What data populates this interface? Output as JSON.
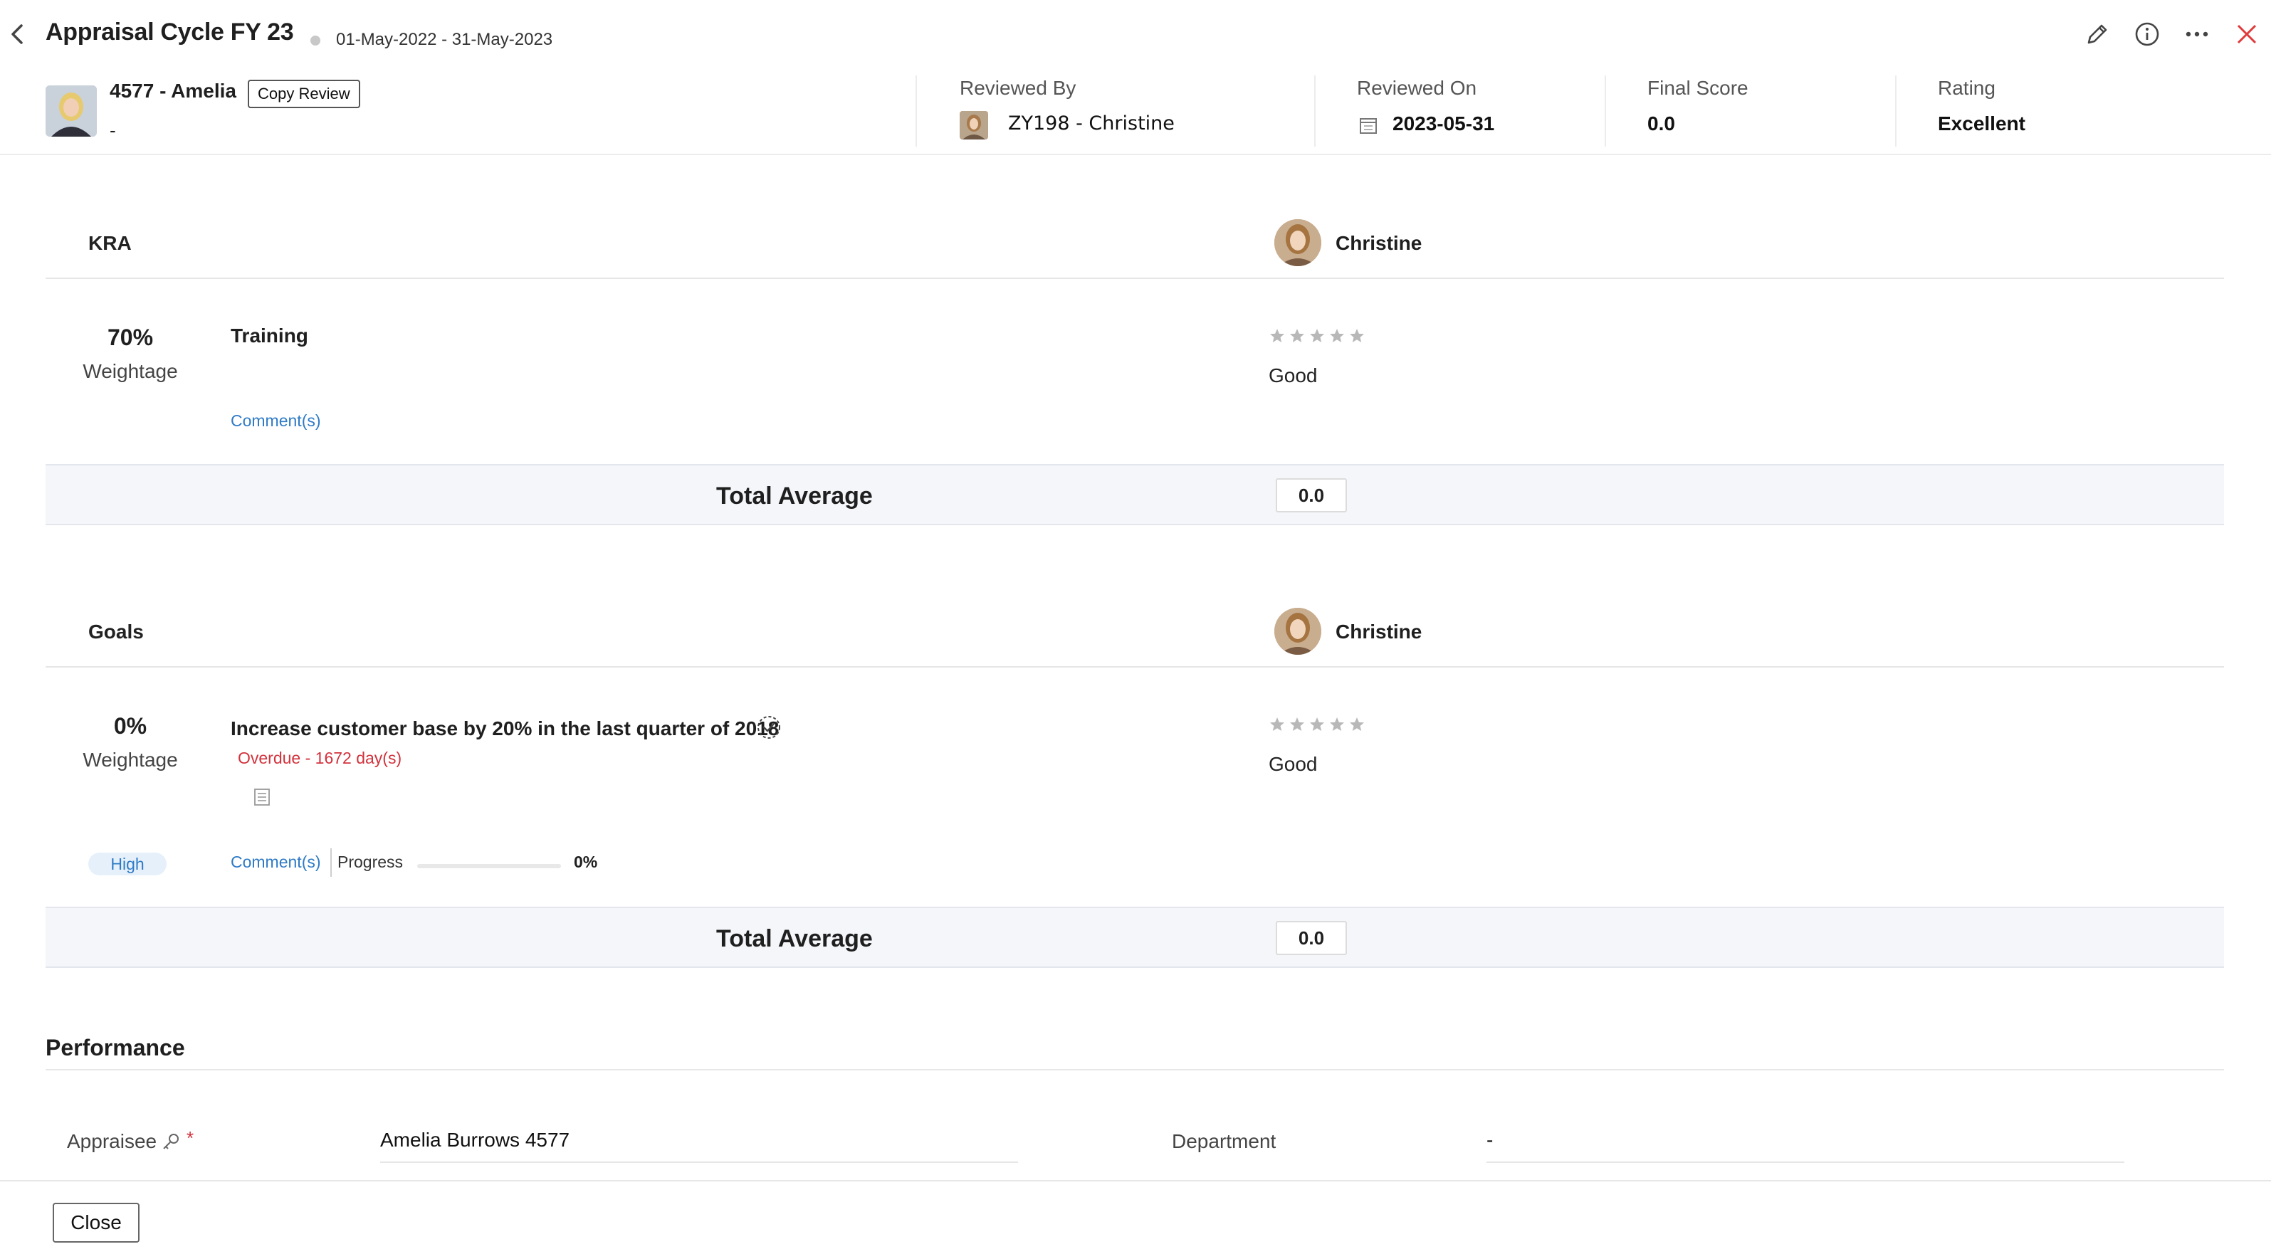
{
  "header": {
    "title": "Appraisal Cycle FY 23",
    "date_range": "01-May-2022 - 31-May-2023",
    "icons": [
      "back-icon",
      "edit-icon",
      "info-icon",
      "more-icon",
      "close-icon"
    ]
  },
  "employee": {
    "name": "4577 - Amelia",
    "subtitle": "-",
    "copy_button": "Copy Review"
  },
  "meta": {
    "reviewed_by_label": "Reviewed By",
    "reviewed_by_value": "ZY198 - Christine",
    "reviewed_on_label": "Reviewed On",
    "reviewed_on_value": "2023-05-31",
    "final_score_label": "Final Score",
    "final_score_value": "0.0",
    "rating_label": "Rating",
    "rating_value": "Excellent"
  },
  "kra": {
    "section_title": "KRA",
    "reviewer": "Christine",
    "item": {
      "weightage_value": "70%",
      "weightage_label": "Weightage",
      "title": "Training",
      "comments_link": "Comment(s)",
      "stars": 0,
      "star_max": 5,
      "rating_text": "Good"
    },
    "total_label": "Total Average",
    "total_value": "0.0"
  },
  "goals": {
    "section_title": "Goals",
    "reviewer": "Christine",
    "item": {
      "weightage_value": "0%",
      "weightage_label": "Weightage",
      "title": "Increase customer base by 20% in the last quarter of 2018",
      "overdue": "Overdue - 1672 day(s)",
      "priority": "High",
      "comments_link": "Comment(s)",
      "progress_label": "Progress",
      "progress_value": "0%",
      "progress_fraction": 0,
      "stars": 0,
      "star_max": 5,
      "rating_text": "Good"
    },
    "total_label": "Total Average",
    "total_value": "0.0"
  },
  "performance": {
    "section_title": "Performance",
    "appraisee_label": "Appraisee",
    "required_mark": "*",
    "appraisee_value": "Amelia Burrows 4577",
    "department_label": "Department",
    "department_value": "-"
  },
  "footer": {
    "close_button": "Close"
  },
  "colors": {
    "link": "#2f7bc6",
    "overdue": "#d2323c",
    "close_icon": "#e03a3a",
    "star": "#b8b8b8",
    "band": "#f4f6fa"
  }
}
